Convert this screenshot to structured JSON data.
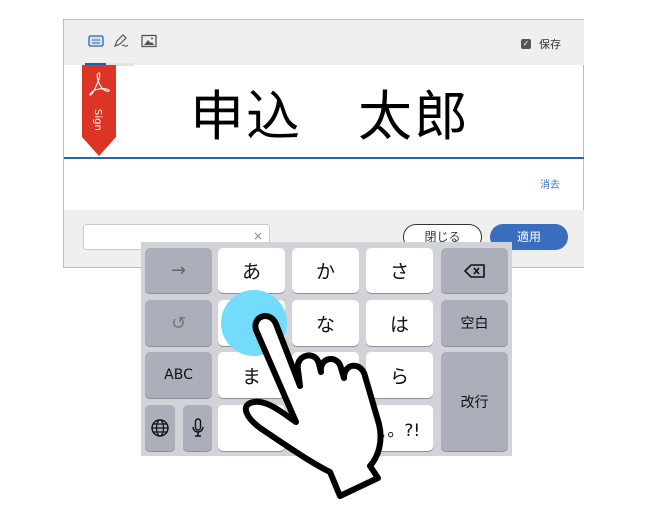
{
  "toolbar": {
    "icons": [
      "keyboard-icon",
      "pen-signature-icon",
      "image-icon"
    ],
    "save_label": "保存",
    "save_checked": true
  },
  "signature": {
    "text": "申込　太郎",
    "ribbon_label": "Sign",
    "clear_label": "消去"
  },
  "footer": {
    "input_value": "",
    "clear_icon": "×",
    "close_label": "閉じる",
    "apply_label": "適用"
  },
  "colors": {
    "accent": "#386ebd",
    "ribbon": "#dc3526",
    "touch": "#74dcfb",
    "keyboard_bg": "#d1d3d9"
  },
  "keyboard": {
    "next": "→",
    "a": "あ",
    "ka": "か",
    "sa": "さ",
    "backspace": "⌫",
    "undo": "↺",
    "na": "な",
    "ha": "は",
    "space": "空白",
    "abc": "ABC",
    "ma": "ま",
    "ra": "ら",
    "enter": "改行",
    "globe": "🌐",
    "mic": "🎤",
    "punct": "、。?!"
  }
}
